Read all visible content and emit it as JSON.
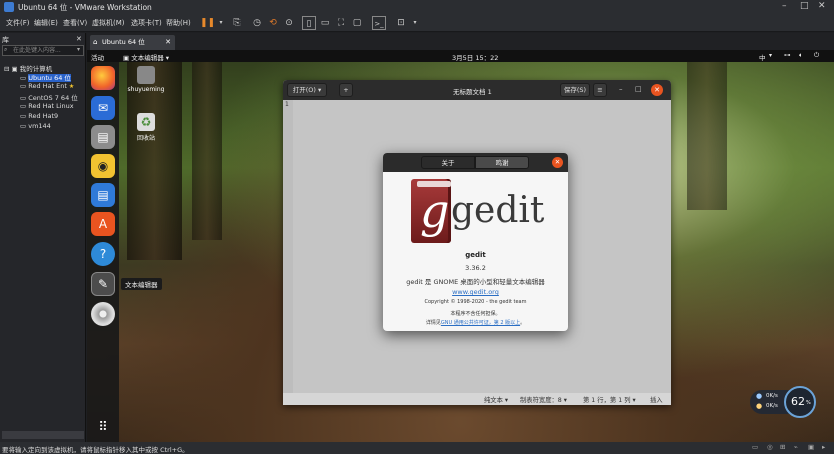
{
  "window": {
    "title": "Ubuntu 64 位 - VMware Workstation"
  },
  "menubar": {
    "items": [
      "文件(F)",
      "编辑(E)",
      "查看(V)",
      "虚拟机(M)",
      "选项卡(T)",
      "帮助(H)"
    ]
  },
  "library": {
    "title": "库",
    "search_placeholder": "在此处键入内容...",
    "root": "我的计算机",
    "items": [
      "Ubuntu 64 位",
      "Red Hat Ent",
      "CentOS 7 64 位",
      "Red Hat Linux",
      "Red Hat9",
      "vm144"
    ]
  },
  "tab": {
    "label": "Ubuntu 64 位"
  },
  "guest": {
    "topbar": {
      "activities": "活动",
      "app_menu": "文本编辑器",
      "clock": "3月5日 15：22",
      "input": "中"
    },
    "desktop": {
      "icons": [
        "shuyueming",
        "回收站"
      ]
    },
    "dock_tooltip": "文本编辑器",
    "gedit": {
      "open": "打开(O)",
      "title": "无标题文档 1",
      "save": "保存(S)",
      "line_number": "1",
      "status": {
        "mode": "纯文本",
        "tab_width": "制表符宽度：8",
        "position": "第 1 行，第 1 列",
        "insert": "插入"
      }
    },
    "about": {
      "tabs": [
        "关于",
        "鸣谢"
      ],
      "logo_text": "gedit",
      "name": "gedit",
      "version": "3.36.2",
      "description": "gedit 是 GNOME 桌面的小型和轻量文本编辑器",
      "website": "www.gedit.org",
      "copyright": "Copyright © 1998-2020 - the gedit team",
      "warranty": "本程序不含任何担保。",
      "license_prefix": "详情见",
      "license_link": "GNU 通用公共许可证，第 2 版以上"
    }
  },
  "network": {
    "up": "0K/s",
    "down": "0K/s",
    "cpu": "62",
    "cpu_unit": "%"
  },
  "statusbar": {
    "text": "要将输入定向到该虚拟机，请将鼠标指针移入其中或按 Ctrl+G。"
  }
}
